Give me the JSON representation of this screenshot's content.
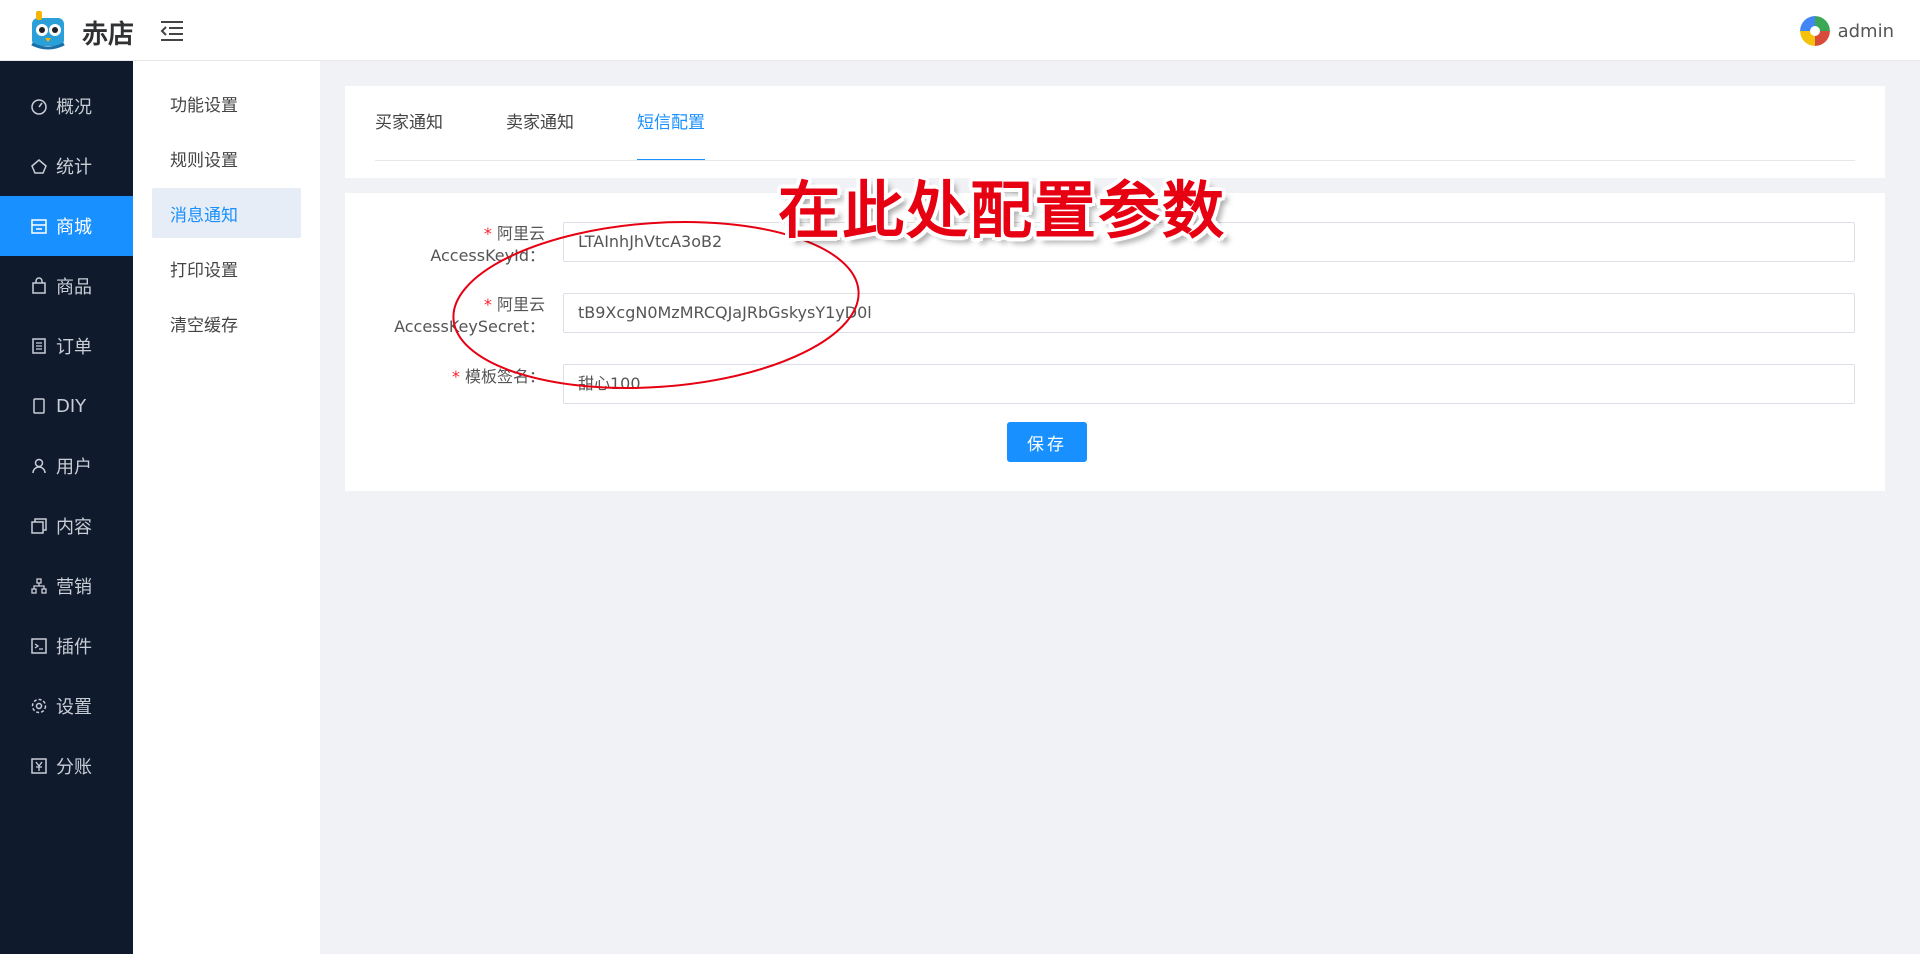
{
  "header": {
    "brand": "赤店",
    "user": "admin"
  },
  "sidebar": {
    "items": [
      {
        "label": "概况",
        "icon": "dashboard-icon"
      },
      {
        "label": "统计",
        "icon": "chart-icon"
      },
      {
        "label": "商城",
        "icon": "store-icon",
        "active": true
      },
      {
        "label": "商品",
        "icon": "bag-icon"
      },
      {
        "label": "订单",
        "icon": "order-icon"
      },
      {
        "label": "DIY",
        "icon": "phone-icon"
      },
      {
        "label": "用户",
        "icon": "user-icon"
      },
      {
        "label": "内容",
        "icon": "content-icon"
      },
      {
        "label": "营销",
        "icon": "network-icon"
      },
      {
        "label": "插件",
        "icon": "plugin-icon"
      },
      {
        "label": "设置",
        "icon": "gear-icon"
      },
      {
        "label": "分账",
        "icon": "yen-icon"
      }
    ]
  },
  "submenu": {
    "items": [
      "功能设置",
      "规则设置",
      "消息通知",
      "打印设置",
      "清空缓存"
    ],
    "active": "消息通知"
  },
  "tabs": {
    "items": [
      "买家通知",
      "卖家通知",
      "短信配置"
    ],
    "active": "短信配置"
  },
  "form": {
    "required_mark": "*",
    "access_key_id": {
      "label_line1": "阿里云",
      "label_line2": "AccessKeyId：",
      "value": "LTAInhJhVtcA3oB2"
    },
    "access_key_secret": {
      "label_line1": "阿里云",
      "label_line2": "AccessKeySecret：",
      "value": "tB9XcgN0MzMRCQJaJRbGskysY1yD0l"
    },
    "template_sign": {
      "label": "模板签名：",
      "value": "甜心100"
    },
    "save_label": "保存"
  },
  "annotation": {
    "text": "在此处配置参数",
    "color": "#e60012"
  },
  "colors": {
    "accent": "#1890ff",
    "sidebar_bg": "#0f1a2c",
    "required": "#f5222d"
  }
}
